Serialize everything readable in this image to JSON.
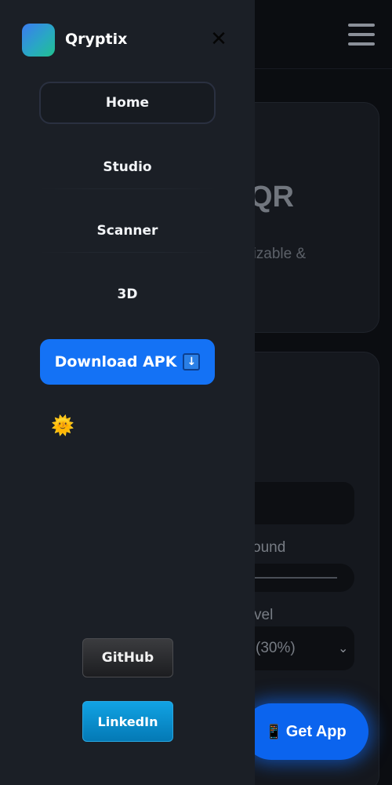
{
  "drawer": {
    "brand": "Qryptix",
    "close_icon": "close-icon",
    "close_glyph": "✕",
    "nav": [
      {
        "label": "Home",
        "active": true
      },
      {
        "label": "Studio",
        "active": false
      },
      {
        "label": "Scanner",
        "active": false
      },
      {
        "label": "3D",
        "active": false
      }
    ],
    "download_label": "Download APK",
    "download_icon": "down-arrow-icon",
    "download_glyph": "↓",
    "theme_glyph": "🌞",
    "github_label": "GitHub",
    "linkedin_label": "LinkedIn"
  },
  "background": {
    "hero_title_fragment": "QR",
    "hero_subtitle_fragment": "nizable &",
    "background_label_fragment": "ound",
    "level_label_fragment": "vel",
    "select_value_fragment": "(30%)",
    "get_app_icon": "📱",
    "get_app_label": "Get App"
  },
  "colors": {
    "accent": "#1472f5",
    "drawer_bg": "#1b1f26",
    "page_bg": "#0b0d11",
    "linkedin": "#0a8fd0"
  }
}
